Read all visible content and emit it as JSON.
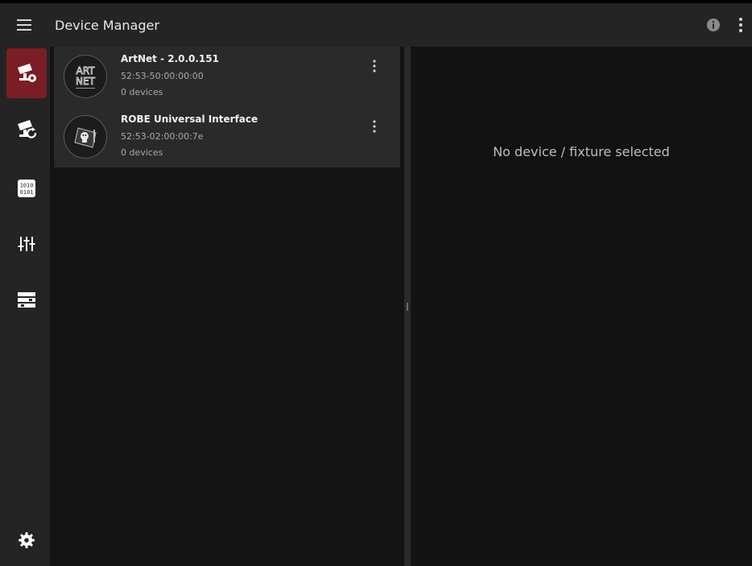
{
  "header": {
    "title": "Device Manager",
    "menu_icon": "hamburger-menu-icon",
    "info_icon": "info-icon",
    "more_icon": "more-vert-icon"
  },
  "sidebar": {
    "items": [
      {
        "icon": "device-settings-icon",
        "active": true
      },
      {
        "icon": "device-refresh-icon",
        "active": false
      },
      {
        "icon": "binary-data-icon",
        "active": false
      },
      {
        "icon": "sliders-icon",
        "active": false
      },
      {
        "icon": "rack-icon",
        "active": false
      },
      {
        "icon": "gear-icon",
        "active": false
      }
    ]
  },
  "devices": [
    {
      "name": "ArtNet - 2.0.0.151",
      "mac": "52:53-50:00:00:00",
      "count": "0 devices",
      "logo": "artnet-logo"
    },
    {
      "name": "ROBE Universal Interface",
      "mac": "52:53-02:00:00:7e",
      "count": "0 devices",
      "logo": "robe-logo"
    }
  ],
  "detail": {
    "empty_message": "No device / fixture selected"
  },
  "colors": {
    "accent": "#7b1d25",
    "header_bg": "#242424",
    "panel_bg": "#121212",
    "list_item_bg": "#2a2a2a"
  }
}
